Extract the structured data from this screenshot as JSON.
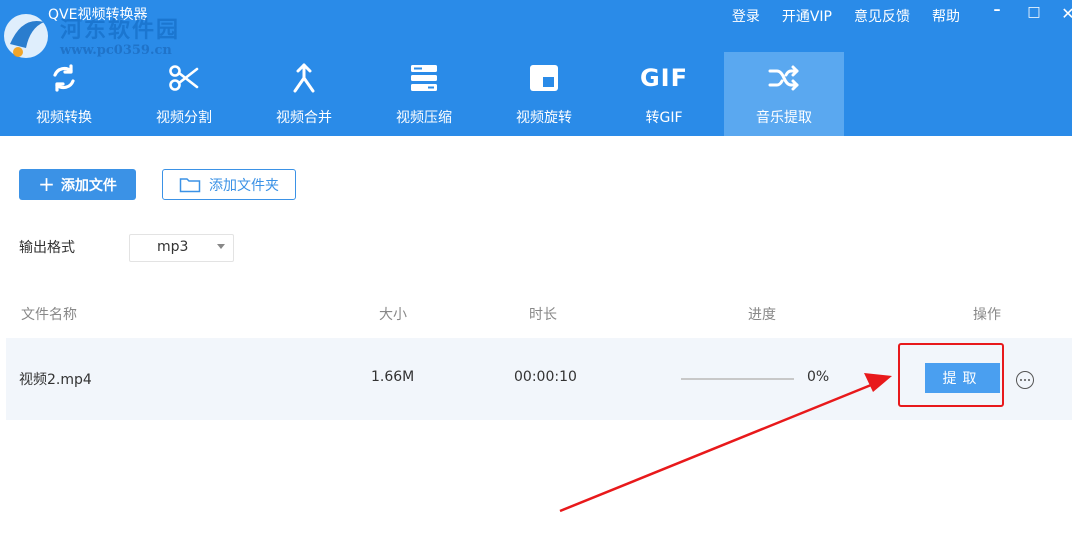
{
  "app": {
    "title": "QVE视频转换器",
    "watermark_text": "河东软件园",
    "watermark_url": "www.pc0359.cn"
  },
  "top_links": [
    {
      "label": "登录"
    },
    {
      "label": "开通VIP"
    },
    {
      "label": "意见反馈"
    },
    {
      "label": "帮助"
    }
  ],
  "window_controls": {
    "minimize": "–",
    "maximize": "□",
    "close": "✕"
  },
  "tools": [
    {
      "label": "视频转换",
      "icon": "refresh-icon"
    },
    {
      "label": "视频分割",
      "icon": "scissors-icon"
    },
    {
      "label": "视频合并",
      "icon": "merge-icon"
    },
    {
      "label": "视频压缩",
      "icon": "compress-icon"
    },
    {
      "label": "视频旋转",
      "icon": "rotate-icon"
    },
    {
      "label": "转GIF",
      "icon": "gif-icon",
      "icon_text": "GIF"
    },
    {
      "label": "音乐提取",
      "icon": "shuffle-icon",
      "active": true
    }
  ],
  "toolbar": {
    "add_file": "添加文件",
    "add_folder": "添加文件夹"
  },
  "output_format": {
    "label": "输出格式",
    "value": "mp3"
  },
  "table": {
    "headers": {
      "name": "文件名称",
      "size": "大小",
      "duration": "时长",
      "progress": "进度",
      "action": "操作"
    },
    "rows": [
      {
        "name": "视频2.mp4",
        "size": "1.66M",
        "duration": "00:00:10",
        "progress_text": "0%",
        "progress": 0,
        "action": "提取"
      }
    ]
  },
  "colors": {
    "header_bg": "#2a8be8",
    "active_tab": "#5aa8f0",
    "primary_button": "#3b92e6",
    "annotation_red": "#e8191b"
  }
}
